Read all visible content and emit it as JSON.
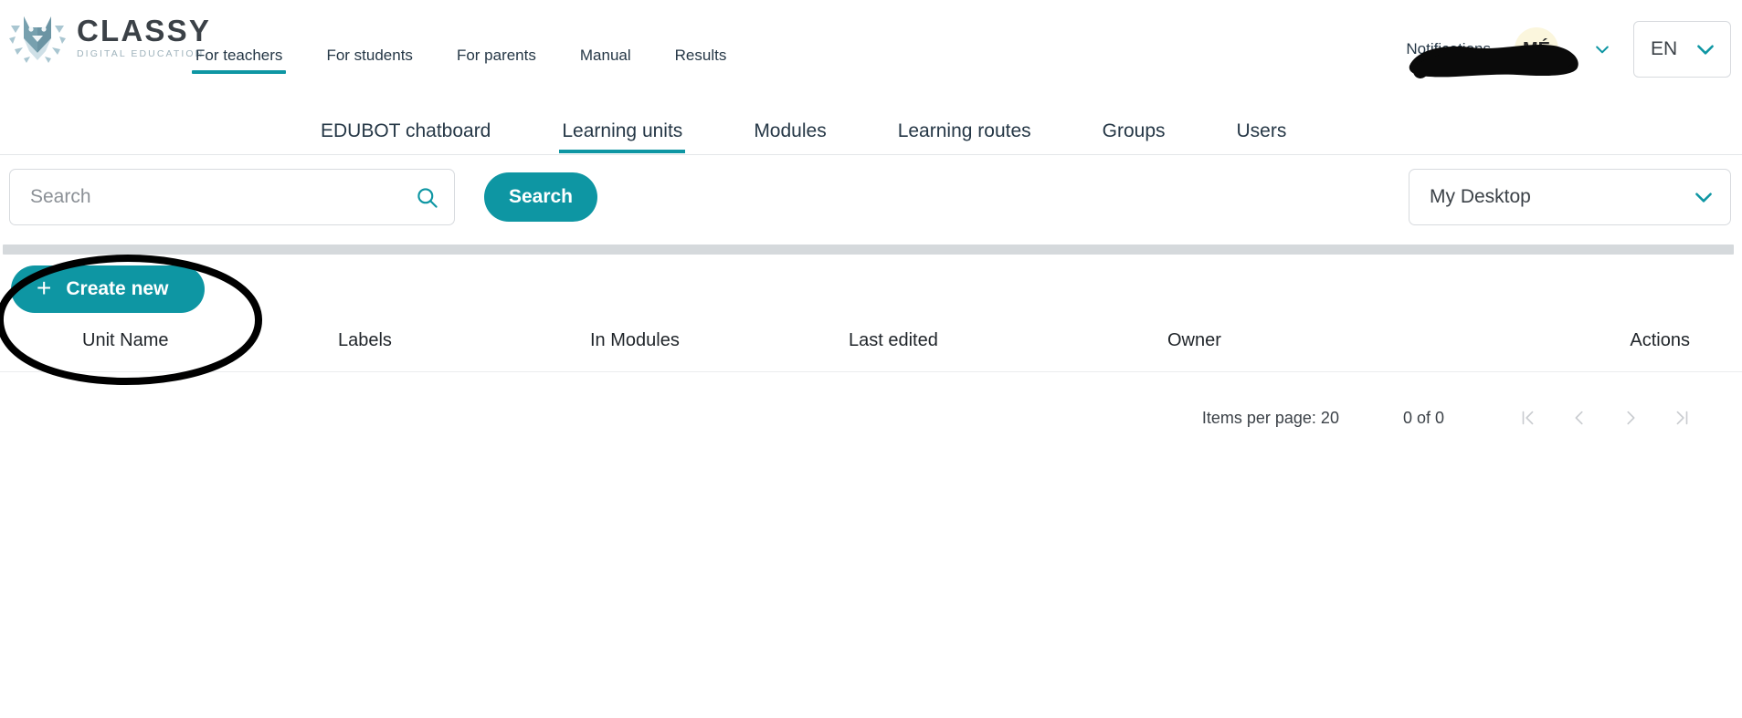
{
  "brand": {
    "name": "CLASSY",
    "tagline": "DIGITAL EDUCATION",
    "logo_icon": "cat-head-logo-icon",
    "logo_color": "#6b94a3",
    "accent_color": "#0e96a3"
  },
  "header": {
    "main_nav": [
      {
        "label": "For teachers",
        "active": true
      },
      {
        "label": "For students",
        "active": false
      },
      {
        "label": "For parents",
        "active": false
      },
      {
        "label": "Manual",
        "active": false
      },
      {
        "label": "Results",
        "active": false
      }
    ],
    "notifications_label": "Notifications",
    "user": {
      "initials": "MÉ",
      "avatar_bg": "#fbf6dd",
      "name": "",
      "redacted": true,
      "chevron_icon": "chevron-down-icon"
    },
    "language": {
      "selected": "EN",
      "chevron_icon": "chevron-down-icon"
    }
  },
  "subnav": [
    {
      "label": "EDUBOT chatboard",
      "active": false
    },
    {
      "label": "Learning units",
      "active": true
    },
    {
      "label": "Modules",
      "active": false
    },
    {
      "label": "Learning routes",
      "active": false
    },
    {
      "label": "Groups",
      "active": false
    },
    {
      "label": "Users",
      "active": false
    }
  ],
  "search": {
    "value": "",
    "placeholder": "Search",
    "icon": "magnifier-icon",
    "button_label": "Search"
  },
  "scope_select": {
    "selected": "My Desktop",
    "chevron_icon": "chevron-down-icon"
  },
  "toolbar": {
    "create_label": "Create new",
    "plus_icon": "plus-icon"
  },
  "table": {
    "columns": [
      "Unit Name",
      "Labels",
      "In Modules",
      "Last edited",
      "Owner",
      "Actions"
    ],
    "rows": []
  },
  "paginator": {
    "items_per_page_label": "Items per page: 20",
    "range_label": "0 of 0",
    "first_icon": "first-page-icon",
    "prev_icon": "previous-page-icon",
    "next_icon": "next-page-icon",
    "last_icon": "last-page-icon",
    "disabled_color": "#c9ccd0"
  },
  "annotation": {
    "type": "hand-drawn-ellipse",
    "color": "#000000",
    "targets": "create-new-button and unit-name-column-header"
  }
}
